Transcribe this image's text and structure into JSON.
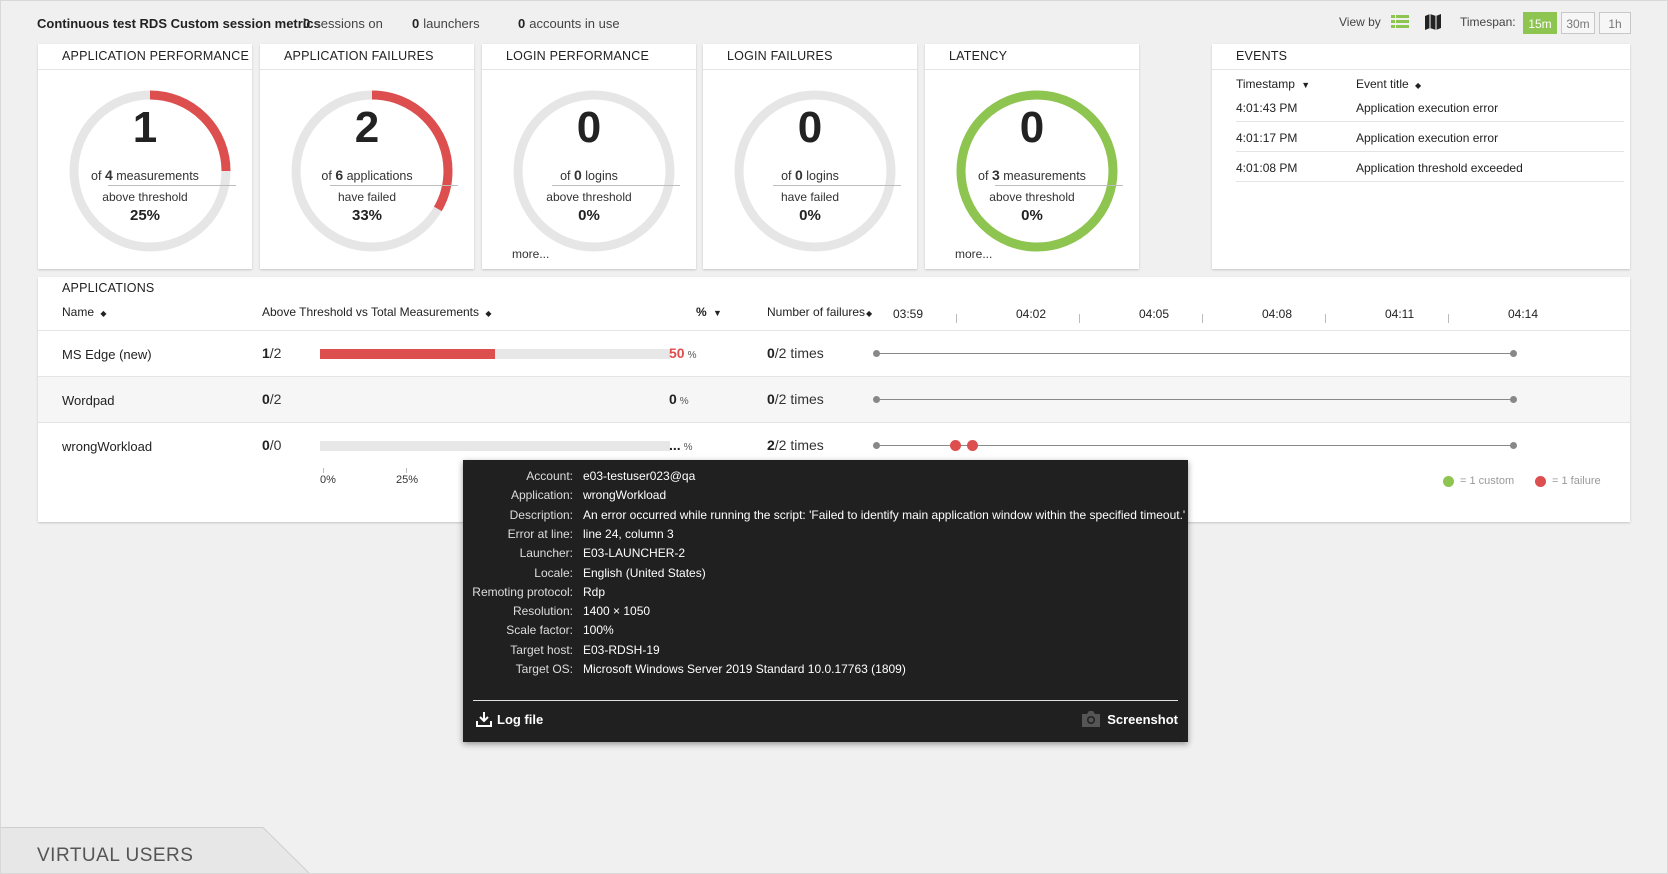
{
  "header": {
    "title": "Continuous test RDS Custom session metrics",
    "sessions_count": "0",
    "sessions_label": "sessions on",
    "launchers_count": "0",
    "launchers_label": "launchers",
    "accounts_count": "0",
    "accounts_label": "accounts in use",
    "view_by_label": "View by",
    "timespan_label": "Timespan:",
    "timespan_options": [
      "15m",
      "30m",
      "1h"
    ],
    "timespan_selected": "15m",
    "accent_color": "#8dc550",
    "view_icons": [
      "list-view-icon",
      "map-view-icon"
    ]
  },
  "cards": [
    {
      "title": "APPLICATION PERFORMANCE",
      "value": "1",
      "of_prefix": "of",
      "of_count": "4",
      "of_label": "measurements",
      "desc": "above threshold",
      "percent": "25%",
      "fraction": 0.25,
      "color": "#dd4e4e",
      "more": ""
    },
    {
      "title": "APPLICATION FAILURES",
      "value": "2",
      "of_prefix": "of",
      "of_count": "6",
      "of_label": "applications",
      "desc": "have failed",
      "percent": "33%",
      "fraction": 0.333,
      "color": "#dd4e4e",
      "more": ""
    },
    {
      "title": "LOGIN PERFORMANCE",
      "value": "0",
      "of_prefix": "of",
      "of_count": "0",
      "of_label": "logins",
      "desc": "above threshold",
      "percent": "0%",
      "fraction": 0,
      "color": "#dd4e4e",
      "more": "more..."
    },
    {
      "title": "LOGIN FAILURES",
      "value": "0",
      "of_prefix": "of",
      "of_count": "0",
      "of_label": "logins",
      "desc": "have failed",
      "percent": "0%",
      "fraction": 0,
      "color": "#dd4e4e",
      "more": ""
    },
    {
      "title": "LATENCY",
      "value": "0",
      "of_prefix": "of",
      "of_count": "3",
      "of_label": "measurements",
      "desc": "above threshold",
      "percent": "0%",
      "fraction": 1,
      "color": "#8dc550",
      "more": "more..."
    }
  ],
  "events": {
    "title": "EVENTS",
    "col_timestamp": "Timestamp",
    "col_event": "Event title",
    "rows": [
      {
        "time": "4:01:43 PM",
        "title": "Application execution error"
      },
      {
        "time": "4:01:17 PM",
        "title": "Application execution error"
      },
      {
        "time": "4:01:08 PM",
        "title": "Application threshold exceeded"
      }
    ]
  },
  "applications": {
    "title": "APPLICATIONS",
    "col_name": "Name",
    "col_ratio": "Above Threshold vs Total Measurements",
    "col_pct": "%",
    "col_failures": "Number of failures",
    "timeline_ticks": [
      "03:59",
      "04:02",
      "04:05",
      "04:08",
      "04:11",
      "04:14"
    ],
    "rows": [
      {
        "name": "MS Edge (new)",
        "above": "1",
        "total": "/2",
        "fraction": 0.5,
        "show_bar": true,
        "pct": "50",
        "pct_color": "#dd4e4e",
        "pct_unit": "%",
        "fail_count": "0",
        "fail_total": "/2 times",
        "failure_points": []
      },
      {
        "name": "Wordpad",
        "above": "0",
        "total": "/2",
        "fraction": 0,
        "show_bar": false,
        "pct": "0",
        "pct_color": "#222222",
        "pct_unit": "%",
        "fail_count": "0",
        "fail_total": "/2 times",
        "failure_points": []
      },
      {
        "name": "wrongWorkload",
        "above": "0",
        "total": "/0",
        "fraction": 0,
        "show_bar": true,
        "pct": "...",
        "pct_color": "#222222",
        "pct_unit": "%",
        "fail_count": "2",
        "fail_total": "/2 times",
        "failure_points": [
          "04:00:52",
          "04:01:17"
        ]
      }
    ],
    "axis_ticks": [
      "0%",
      "25%"
    ],
    "legend_custom": "= 1 custom",
    "legend_failure": "= 1 failure",
    "legend_custom_color": "#8dc550",
    "legend_failure_color": "#dd4e4e"
  },
  "tooltip": {
    "rows": [
      {
        "key": "Account:",
        "value": "e03-testuser023@qa"
      },
      {
        "key": "Application:",
        "value": "wrongWorkload"
      },
      {
        "key": "Description:",
        "value": "An error occurred while running the script: 'Failed to identify main application window within the specified timeout.'"
      },
      {
        "key": "Error at line:",
        "value": "line 24, column 3"
      },
      {
        "key": "Launcher:",
        "value": "E03-LAUNCHER-2"
      },
      {
        "key": "Locale:",
        "value": "English (United States)"
      },
      {
        "key": "Remoting protocol:",
        "value": "Rdp"
      },
      {
        "key": "Resolution:",
        "value": "1400 × 1050"
      },
      {
        "key": "Scale factor:",
        "value": "100%"
      },
      {
        "key": "Target host:",
        "value": "E03-RDSH-19"
      },
      {
        "key": "Target OS:",
        "value": "Microsoft Windows Server 2019 Standard 10.0.17763 (1809)"
      }
    ],
    "log_file_label": "Log file",
    "screenshot_label": "Screenshot"
  },
  "virtual_users": {
    "label": "VIRTUAL USERS"
  }
}
